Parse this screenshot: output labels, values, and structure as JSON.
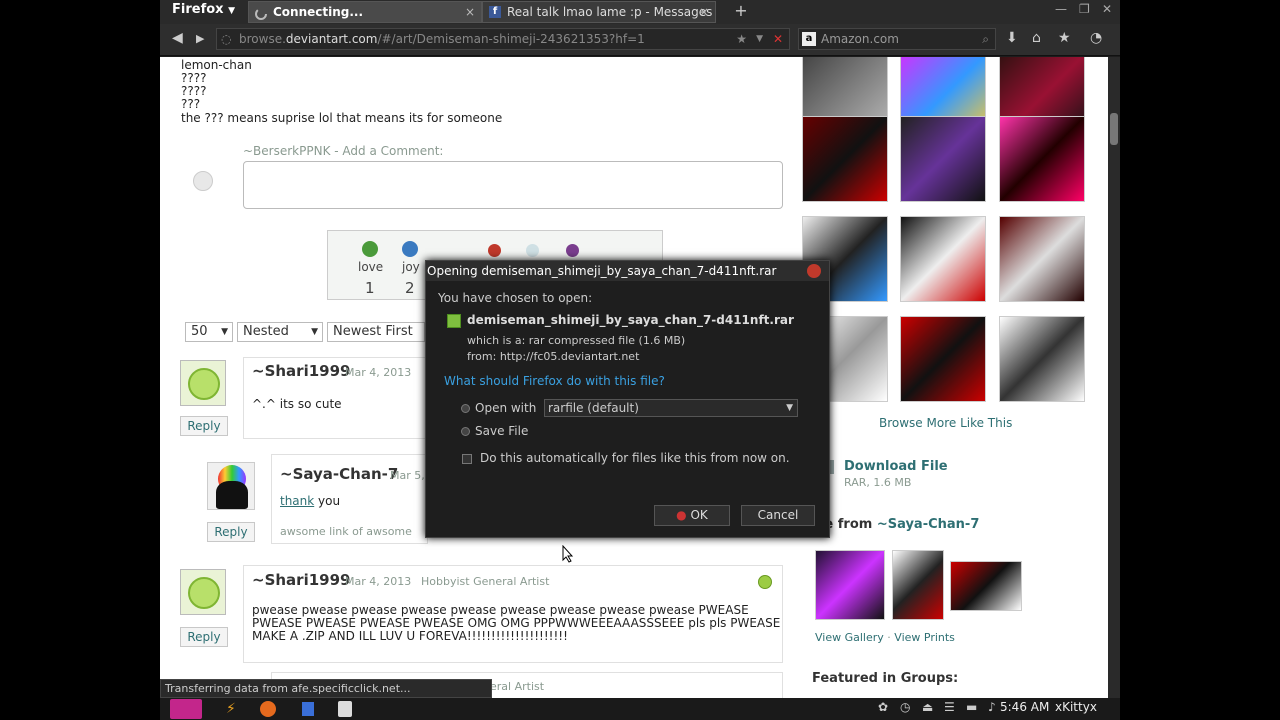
{
  "browser": {
    "firefox_button": "Firefox",
    "tabs": [
      {
        "title": "Connecting...",
        "active": true
      },
      {
        "title": "Real talk lmao lame :p - Messages",
        "active": false
      }
    ],
    "url_prefix": "browse.",
    "url_host": "deviantart.com",
    "url_rest": "/#/art/Demiseman-shimeji-243621353?hf=1",
    "search_placeholder": "Amazon.com"
  },
  "page": {
    "lines": [
      "lemon-chan",
      "????",
      "????",
      "???",
      "the ??? means suprise lol that means its for someone"
    ],
    "comment_prompt_user": "~BerserkPPNK",
    "comment_prompt_action": " - Add a Comment:",
    "moods": [
      {
        "label": "love",
        "count": "1"
      },
      {
        "label": "joy",
        "count": "2"
      }
    ],
    "filters": {
      "per_page": "50",
      "thread": "Nested",
      "order": "Newest First"
    },
    "comments": [
      {
        "user": "~Shari1999",
        "date": "Mar 4, 2013",
        "text": "^.^ its so cute",
        "reply": "Reply"
      },
      {
        "user": "~Saya-Chan-7",
        "date": "Mar 5,",
        "text_link": "thank",
        "text": " you",
        "sub": "awsome link of awsome",
        "reply": "Reply"
      },
      {
        "user": "~Shari1999",
        "date": "Mar 4, 2013",
        "role": "Hobbyist General Artist",
        "text1": "pwease pwease pwease pwease pwease pwease pwease pwease pwease PWEASE",
        "text2": "PWEASE PWEASE PWEASE PWEASE OMG OMG PPPWWWEEEAAASSSEEE pls pls PWEASE",
        "text3": "MAKE A .ZIP AND ILL LUV U FOREVA!!!!!!!!!!!!!!!!!!!!!",
        "reply": "Reply"
      }
    ],
    "partial_role": "eral Artist",
    "sidebar": {
      "browse_more": "Browse More Like This",
      "download_title": "Download File",
      "download_meta": "RAR, 1.6 MB",
      "more_from": "re from ",
      "more_from_user": "~Saya-Chan-7",
      "view_gallery": "View Gallery",
      "separator": " · ",
      "view_prints": "View Prints",
      "featured": "Featured in Groups:"
    }
  },
  "dialog": {
    "title": "Opening demiseman_shimeji_by_saya_chan_7-d411nft.rar",
    "chosen": "You have chosen to open:",
    "filename": "demiseman_shimeji_by_saya_chan_7-d411nft.rar",
    "which_is_label": "which is a:",
    "which_is_value": "rar compressed file (1.6 MB)",
    "from_label": "from:",
    "from_value": "http://fc05.deviantart.net",
    "question": "What should Firefox do with this file?",
    "open_with": "Open with",
    "open_with_app": "rarfile (default)",
    "save_file": "Save File",
    "auto": "Do this automatically for files like this from now on.",
    "ok": "OK",
    "cancel": "Cancel"
  },
  "status_text": "Transferring data from afe.specificclick.net...",
  "taskbar": {
    "time": "5:46 AM",
    "user": "xKittyx"
  },
  "colors": {
    "accent": "#2e6f73",
    "dialog_link": "#3aa0e0"
  }
}
